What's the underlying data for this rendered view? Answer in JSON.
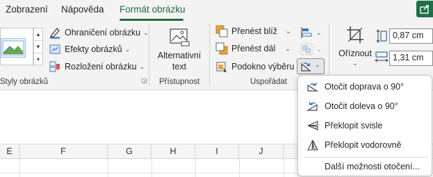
{
  "tabs": [
    {
      "label": "Zobrazení",
      "active": false
    },
    {
      "label": "Nápověda",
      "active": false
    },
    {
      "label": "Formát obrázku",
      "active": true
    }
  ],
  "picture_styles_group": {
    "border_label": "Ohraničení obrázku",
    "effects_label": "Efekty obrázků",
    "layout_label": "Rozložení obrázku",
    "group_label": "Styly obrázků"
  },
  "accessibility_group": {
    "alt_text_line1": "Alternativní",
    "alt_text_line2": "text",
    "group_label": "Přístupnost"
  },
  "arrange_group": {
    "bring_forward": "Přenést blíž",
    "send_backward": "Přenést dál",
    "selection_pane": "Podokno výběru",
    "group_label": "Uspořádat"
  },
  "size_group": {
    "crop_label": "Oříznout",
    "height_value": "0,87 cm",
    "width_value": "1,31 cm"
  },
  "rotate_menu": {
    "items": [
      {
        "label": "Otočit doprava o 90°",
        "icon": "rotate-right-icon"
      },
      {
        "label": "Otočit doleva o 90°",
        "icon": "rotate-left-icon"
      },
      {
        "label": "Překlopit svisle",
        "icon": "flip-vertical-icon"
      },
      {
        "label": "Překlopit vodorovně",
        "icon": "flip-horizontal-icon"
      }
    ],
    "more": "Další možnosti otočení..."
  },
  "sheet": {
    "columns": [
      "E",
      "F",
      "G",
      "H",
      "I",
      "J"
    ]
  },
  "colors": {
    "accent": "#1e6b3f",
    "ribbon_bg": "#f3f3f3",
    "icon_blue": "#2b6cb0",
    "icon_orange": "#e8a33d"
  }
}
